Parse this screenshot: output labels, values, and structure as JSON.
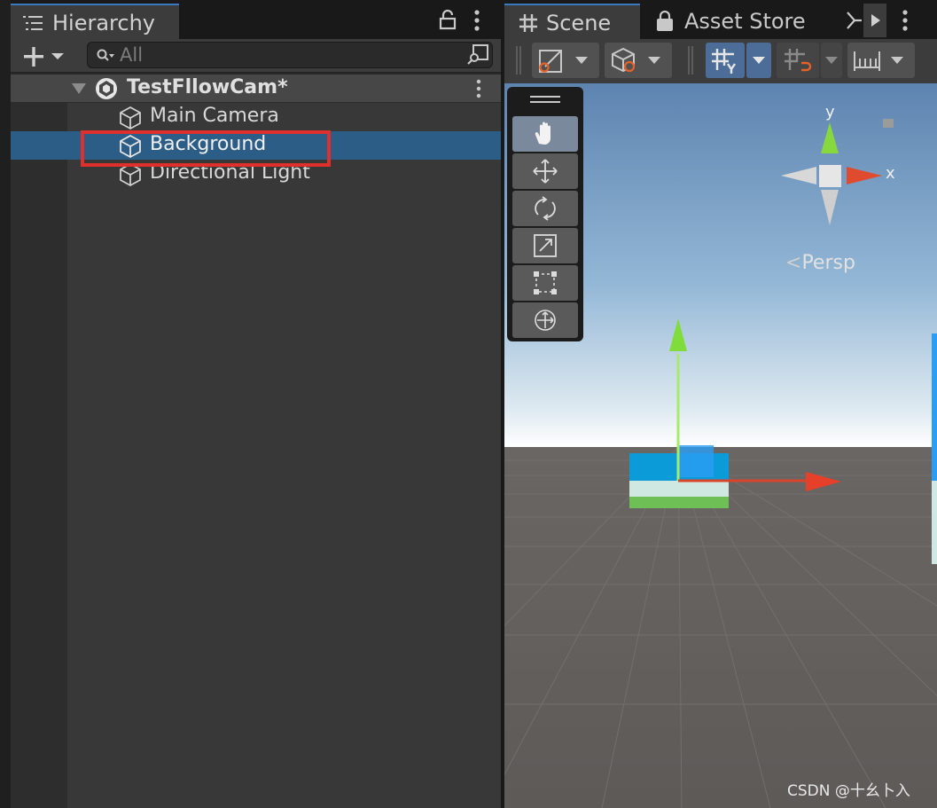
{
  "hierarchy": {
    "tab_title": "Hierarchy",
    "search_placeholder": "All",
    "scene_name": "TestFllowCam*",
    "items": [
      {
        "label": "Main Camera"
      },
      {
        "label": "Background",
        "selected": true
      },
      {
        "label": "Directional Light"
      }
    ]
  },
  "scene_panel": {
    "tabs": [
      {
        "label": "Scene",
        "icon": "grid-icon",
        "active": true
      },
      {
        "label": "Asset Store",
        "icon": "store-bag-icon",
        "active": false
      }
    ],
    "projection_label": "Persp",
    "gizmo_axes": {
      "y": "y",
      "x": "x"
    }
  },
  "watermark": "CSDN @十幺卜入",
  "colors": {
    "accent": "#3a79bb",
    "selection": "#2c5d87",
    "highlight_box": "#e0302e",
    "gizmo_y": "#7fdc3a",
    "gizmo_x": "#e6402a"
  }
}
